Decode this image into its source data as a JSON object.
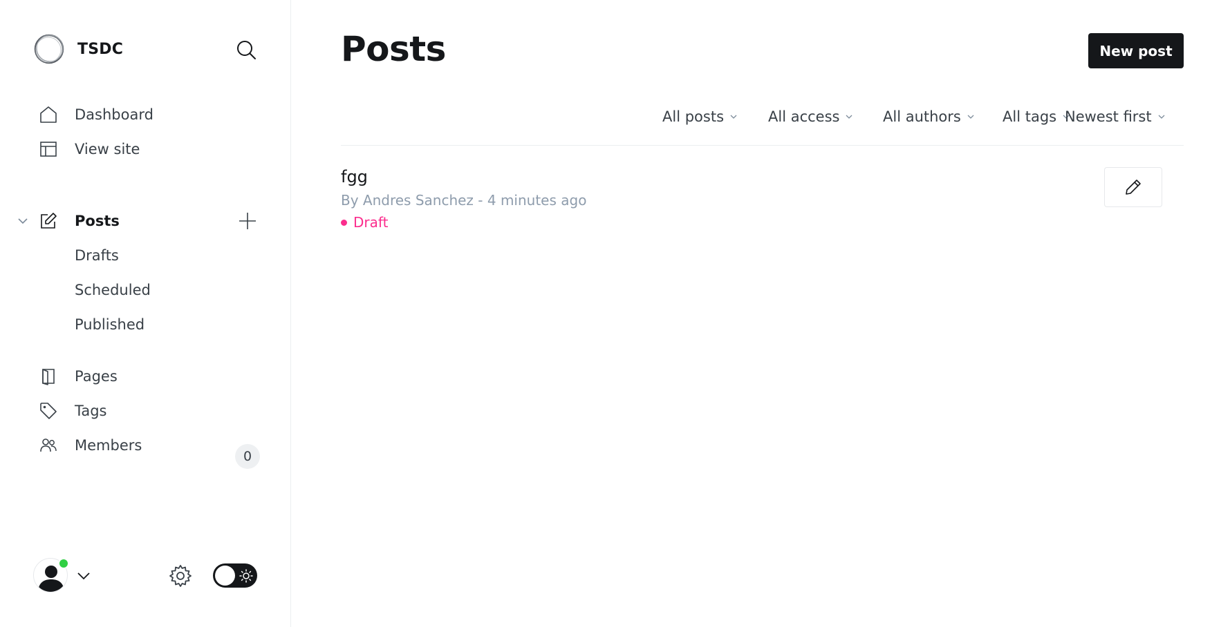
{
  "sidebar": {
    "brand_name": "TSDC",
    "nav_top": [
      {
        "label": "Dashboard",
        "icon": "home-icon"
      },
      {
        "label": "View site",
        "icon": "layout-icon"
      }
    ],
    "posts_section": {
      "label": "Posts",
      "icon": "edit-icon",
      "subitems": [
        "Drafts",
        "Scheduled",
        "Published"
      ]
    },
    "nav_bottom": [
      {
        "label": "Pages",
        "icon": "pages-icon"
      },
      {
        "label": "Tags",
        "icon": "tag-icon"
      },
      {
        "label": "Members",
        "icon": "members-icon",
        "badge": "0"
      }
    ]
  },
  "main": {
    "title": "Posts",
    "new_post_label": "New post",
    "filters": [
      "All posts",
      "All access",
      "All authors",
      "All tags",
      "Newest first"
    ],
    "posts": [
      {
        "title": "fgg",
        "meta": "By Andres Sanchez - 4 minutes ago",
        "status": "Draft"
      }
    ]
  },
  "colors": {
    "accent_dark": "#15171a",
    "draft_pink": "#fb2d8d",
    "online_green": "#30cf43",
    "muted_text": "#8e9cac"
  }
}
